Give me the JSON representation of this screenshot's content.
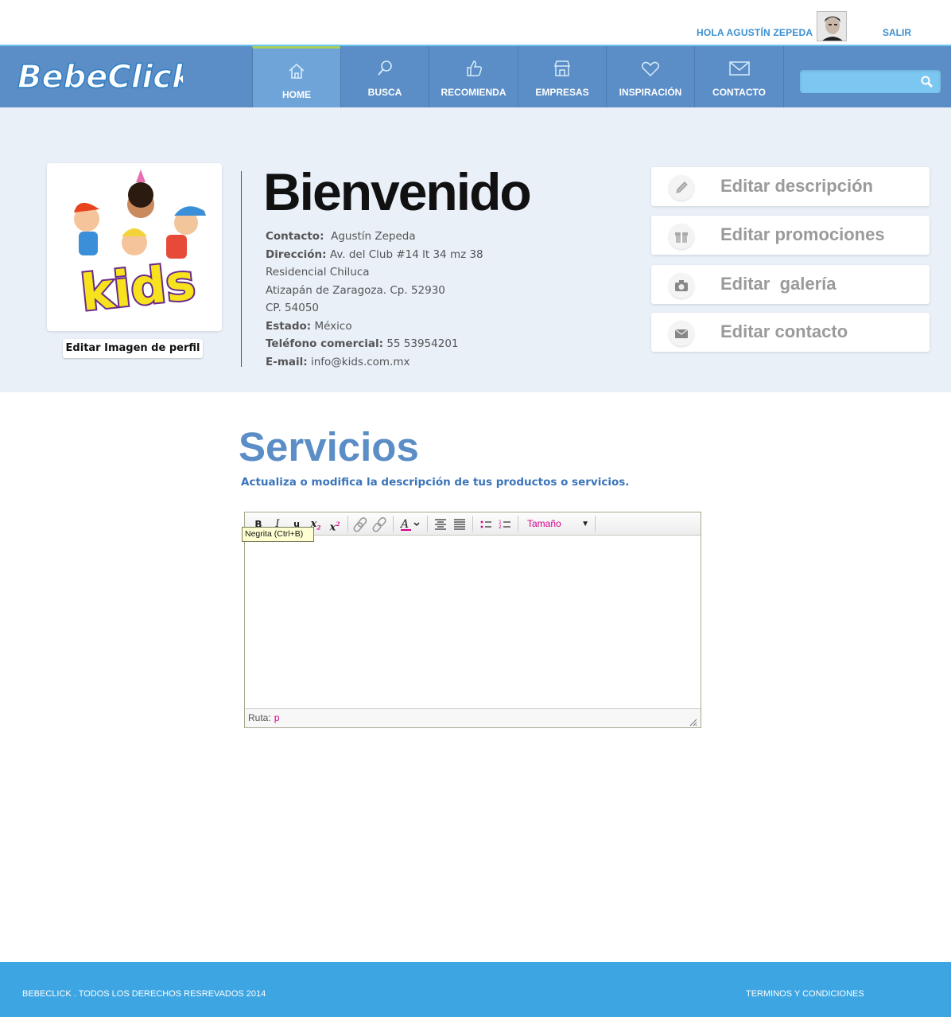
{
  "header": {
    "greeting": "HOLA AGUSTÍN ZEPEDA",
    "logout": "SALIR"
  },
  "brand": {
    "name": "BebeClick",
    "colors": {
      "nav": "#5b8dc6",
      "accent": "#3a8fd1",
      "footer": "#3da5e2",
      "active_tab": "#6fa4d8"
    }
  },
  "nav": {
    "items": [
      {
        "label": "HOME",
        "icon": "home-icon",
        "active": true
      },
      {
        "label": "BUSCA",
        "icon": "search-icon",
        "active": false
      },
      {
        "label": "RECOMIENDA",
        "icon": "thumbs-up-icon",
        "active": false
      },
      {
        "label": "EMPRESAS",
        "icon": "store-icon",
        "active": false
      },
      {
        "label": "INSPIRACIÓN",
        "icon": "heart-icon",
        "active": false
      },
      {
        "label": "CONTACTO",
        "icon": "envelope-icon",
        "active": false
      }
    ],
    "search_placeholder": ""
  },
  "profile": {
    "title": "Bienvenido",
    "edit_image": "Editar Imagen de perfil",
    "logo_text": "kids",
    "contact_label": "Contacto:",
    "contact_value": "Agustín Zepeda",
    "address_label": "Dirección:",
    "address_line1": "Av. del Club #14 lt 34 mz 38",
    "address_line2": "Residencial Chiluca",
    "address_line3": "Atizapán de Zaragoza. Cp. 52930",
    "address_line4": "CP. 54050",
    "state_label": "Estado:",
    "state_value": "México",
    "phone_label": "Teléfono comercial:",
    "phone_value": "55 53954201",
    "email_label": "E-mail:",
    "email_value": "info@kids.com.mx"
  },
  "actions": [
    {
      "label": "Editar descripción",
      "icon": "pencil-icon"
    },
    {
      "label": "Editar promociones",
      "icon": "gift-icon"
    },
    {
      "label": "Editar  galería",
      "icon": "camera-icon"
    },
    {
      "label": "Editar contacto",
      "icon": "envelope-icon"
    }
  ],
  "services": {
    "title": "Servicios",
    "subtitle": "Actualiza o modifica la descripción de tus productos o servicios."
  },
  "editor": {
    "tooltip": "Negrita (Ctrl+B)",
    "size_select": "Tamaño",
    "path_label": "Ruta:",
    "path_value": "p",
    "content": ""
  },
  "footer": {
    "copyright": "BEBECLICK . TODOS LOS DERECHOS RESREVADOS 2014",
    "terms": "TERMINOS Y CONDICIONES"
  }
}
